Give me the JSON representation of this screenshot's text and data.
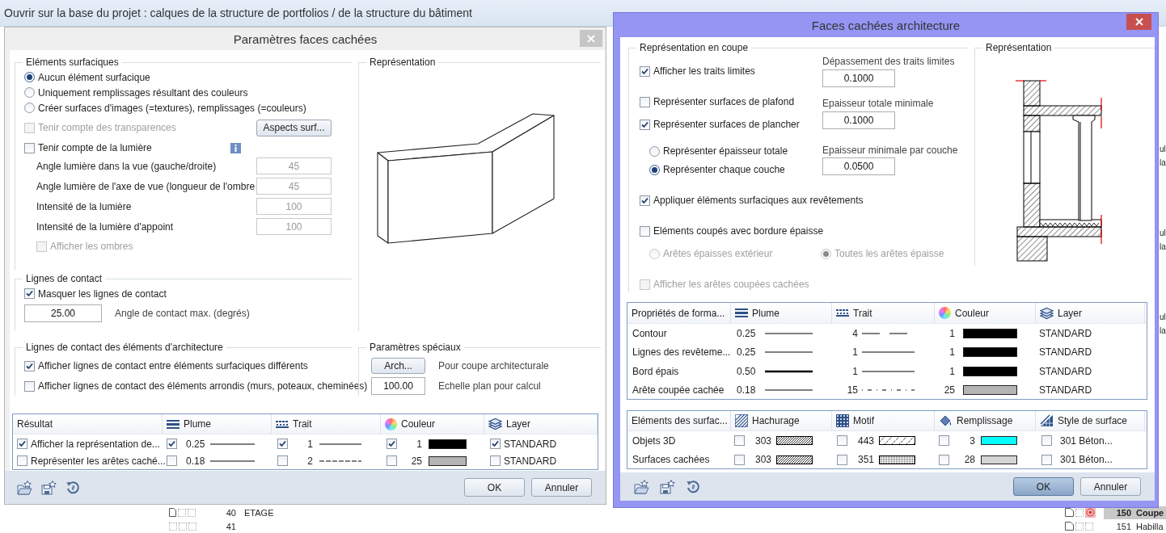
{
  "background": {
    "title": "Ouvrir sur la base du projet : calques de la structure de portfolios / de la structure du bâtiment",
    "left_rows": [
      {
        "number": "40",
        "label": "ETAGE"
      },
      {
        "number": "41"
      }
    ],
    "right_rows": [
      {
        "number": "150",
        "label": "Coupe",
        "selected": true
      },
      {
        "number": "151",
        "label": "Habilla",
        "selected": false
      }
    ],
    "edge_fragments": [
      [
        "ul",
        "la"
      ],
      [
        "ul",
        "la"
      ],
      [
        "ul",
        "la"
      ]
    ]
  },
  "hidden_faces": {
    "title": "Paramètres faces cachées",
    "surface_group": {
      "title": "Eléments surfaciques",
      "options": [
        {
          "label": "Aucun élément surfacique",
          "selected": true
        },
        {
          "label": "Uniquement remplissages résultant des couleurs",
          "selected": false
        },
        {
          "label": "Créer surfaces d'images (=textures), remplissages (=couleurs)",
          "selected": false
        }
      ],
      "transparency": {
        "label": "Tenir compte des transparences",
        "checked": false,
        "disabled": true
      },
      "aspects_button": "Aspects surf...",
      "light": {
        "label": "Tenir compte de la lumière",
        "checked": false
      },
      "light_fields": [
        {
          "label": "Angle lumière dans la vue (gauche/droite)",
          "value": "45",
          "disabled": true
        },
        {
          "label": "Angle lumière de l'axe de vue (longueur de l'ombre",
          "value": "45",
          "disabled": true
        },
        {
          "label": "Intensité de la lumière",
          "value": "100",
          "disabled": true
        },
        {
          "label": "Intensité de la lumière d'appoint",
          "value": "100",
          "disabled": true
        }
      ],
      "shadows": {
        "label": "Afficher les ombres",
        "checked": false,
        "disabled": true
      }
    },
    "preview": {
      "title": "Représentation"
    },
    "contact_group": {
      "title": "Lignes de contact",
      "mask": {
        "label": "Masquer les lignes de contact",
        "checked": true
      },
      "angle_value": "25.00",
      "angle_label": "Angle de contact max. (degrés)"
    },
    "arch_contact_group": {
      "title": "Lignes de contact des éléments d'architecture",
      "options": [
        {
          "label": "Afficher lignes de contact entre éléments surfaciques différents",
          "checked": true
        },
        {
          "label": "Afficher lignes de contact des éléments arrondis (murs, poteaux, cheminées)",
          "checked": false
        }
      ]
    },
    "special_group": {
      "title": "Paramètres spéciaux",
      "arch_button": "Arch...",
      "arch_note": "Pour coupe architecturale",
      "scale_value": "100.00",
      "scale_label": "Echelle plan pour calcul"
    },
    "result_table": {
      "columns": [
        {
          "label": "Résultat",
          "kind": "plain"
        },
        {
          "label": "Plume",
          "kind": "pen"
        },
        {
          "label": "Trait",
          "kind": "line"
        },
        {
          "label": "Couleur",
          "kind": "color"
        },
        {
          "label": "Layer",
          "kind": "layer"
        }
      ],
      "rows": [
        {
          "label": "Afficher la représentation de...",
          "checked": true,
          "pen": {
            "checked": true,
            "value": "0.25",
            "kind": "thin"
          },
          "line": {
            "checked": true,
            "value": "1",
            "kind": "solid"
          },
          "color": {
            "checked": true,
            "value": "1",
            "color": "#000000"
          },
          "layer": {
            "checked": true,
            "value": "STANDARD"
          }
        },
        {
          "label": "Représenter les arêtes caché...",
          "checked": false,
          "pen": {
            "checked": false,
            "value": "0.18",
            "kind": "thin"
          },
          "line": {
            "checked": false,
            "value": "2",
            "kind": "dashed"
          },
          "color": {
            "checked": false,
            "value": "25",
            "color": "#b4b4b4"
          },
          "layer": {
            "checked": false,
            "value": "STANDARD"
          }
        }
      ]
    },
    "buttons": [
      {
        "label": "OK",
        "focused": false
      },
      {
        "label": "Annuler",
        "focused": false
      }
    ]
  },
  "arch": {
    "title": "Faces cachées architecture",
    "section_group": {
      "title": "Représentation en coupe",
      "show_limits": {
        "label": "Afficher les traits limites",
        "checked": true
      },
      "ceiling": {
        "label": "Représenter surfaces de plafond",
        "checked": false
      },
      "floor": {
        "label": "Représenter surfaces de plancher",
        "checked": true
      },
      "thickness_options": [
        {
          "label": "Représenter épaisseur totale",
          "selected": false
        },
        {
          "label": "Représenter chaque couche",
          "selected": true
        }
      ],
      "fields": [
        {
          "label": "Dépassement des traits limites",
          "value": "0.1000"
        },
        {
          "label": "Epaisseur totale minimale",
          "value": "0.1000"
        },
        {
          "label": "Epaisseur minimale par couche",
          "value": "0.0500"
        }
      ],
      "apply_surfaces": {
        "label": "Appliquer éléments surfaciques aux revêtements",
        "checked": true
      },
      "thick_border": {
        "label": "Eléments coupés avec bordure épaisse",
        "checked": false
      },
      "edge_options": [
        {
          "label": "Arêtes épaisses extérieur",
          "selected": false,
          "disabled": true
        },
        {
          "label": "Toutes les arêtes épaisse",
          "selected": true,
          "disabled": true
        }
      ],
      "hidden_cut_edges": {
        "label": "Afficher les arêtes coupées cachées",
        "checked": false,
        "disabled": true
      }
    },
    "preview": {
      "title": "Représentation"
    },
    "format_table": {
      "columns": [
        {
          "label": "Propriétés de forma...",
          "kind": "plain"
        },
        {
          "label": "Plume",
          "kind": "pen"
        },
        {
          "label": "Trait",
          "kind": "line"
        },
        {
          "label": "Couleur",
          "kind": "color"
        },
        {
          "label": "Layer",
          "kind": "layer"
        }
      ],
      "rows": [
        {
          "label": "Contour",
          "pen": {
            "value": "0.25",
            "kind": "thin"
          },
          "line": {
            "value": "4",
            "kind": "dash_dot"
          },
          "color": {
            "value": "1",
            "color": "#000000"
          },
          "layer": "STANDARD"
        },
        {
          "label": "Lignes des revêteme...",
          "pen": {
            "value": "0.25",
            "kind": "thin"
          },
          "line": {
            "value": "1",
            "kind": "solid"
          },
          "color": {
            "value": "1",
            "color": "#000000"
          },
          "layer": "STANDARD"
        },
        {
          "label": "Bord épais",
          "pen": {
            "value": "0.50",
            "kind": "thick"
          },
          "line": {
            "value": "1",
            "kind": "solid"
          },
          "color": {
            "value": "1",
            "color": "#000000"
          },
          "layer": "STANDARD"
        },
        {
          "label": "Arête coupée cachée",
          "pen": {
            "value": "0.18",
            "kind": "thin"
          },
          "line": {
            "value": "15",
            "kind": "dotted"
          },
          "color": {
            "value": "25",
            "color": "#b4b4b4"
          },
          "layer": "STANDARD"
        }
      ]
    },
    "surface_table": {
      "columns": [
        {
          "label": "Eléments des surfac...",
          "kind": "plain"
        },
        {
          "label": "Hachurage",
          "kind": "hatch"
        },
        {
          "label": "Motif",
          "kind": "pattern"
        },
        {
          "label": "Remplissage",
          "kind": "fill"
        },
        {
          "label": "Style de surface",
          "kind": "surface_style"
        }
      ],
      "rows": [
        {
          "label": "Objets 3D",
          "hatch": {
            "checked": false,
            "value": "303",
            "kind": "hatch_diagonal"
          },
          "pattern": {
            "checked": false,
            "value": "443",
            "kind": "diagonal_dash"
          },
          "fill": {
            "checked": false,
            "value": "3",
            "color": "#00ffff"
          },
          "style": {
            "checked": false,
            "value": "301 Béton..."
          }
        },
        {
          "label": "Surfaces cachées",
          "hatch": {
            "checked": false,
            "value": "303",
            "kind": "hatch_diagonal"
          },
          "pattern": {
            "checked": false,
            "value": "351",
            "kind": "dots"
          },
          "fill": {
            "checked": false,
            "value": "28",
            "color": "#d4d4d4"
          },
          "style": {
            "checked": false,
            "value": "301 Béton..."
          }
        }
      ]
    },
    "buttons": [
      {
        "label": "OK",
        "focused": true
      },
      {
        "label": "Annuler",
        "focused": false
      }
    ]
  }
}
